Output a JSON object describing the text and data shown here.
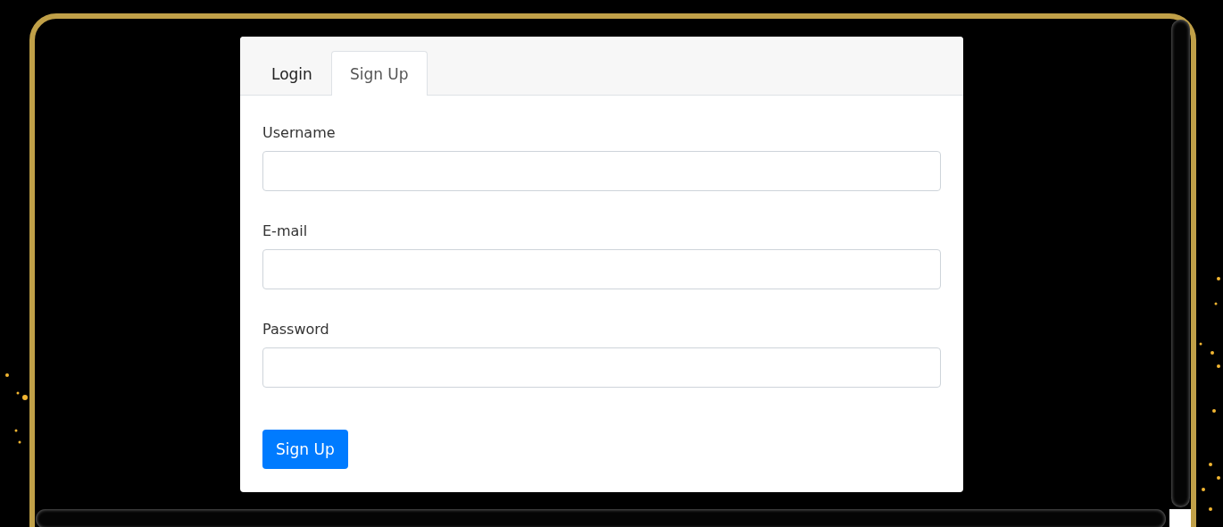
{
  "tabs": [
    {
      "label": "Login",
      "selected": false
    },
    {
      "label": "Sign Up",
      "selected": true
    }
  ],
  "fields": [
    {
      "label": "Username"
    },
    {
      "label": "E-mail"
    },
    {
      "label": "Password"
    }
  ],
  "submit": {
    "label": "Sign Up"
  }
}
